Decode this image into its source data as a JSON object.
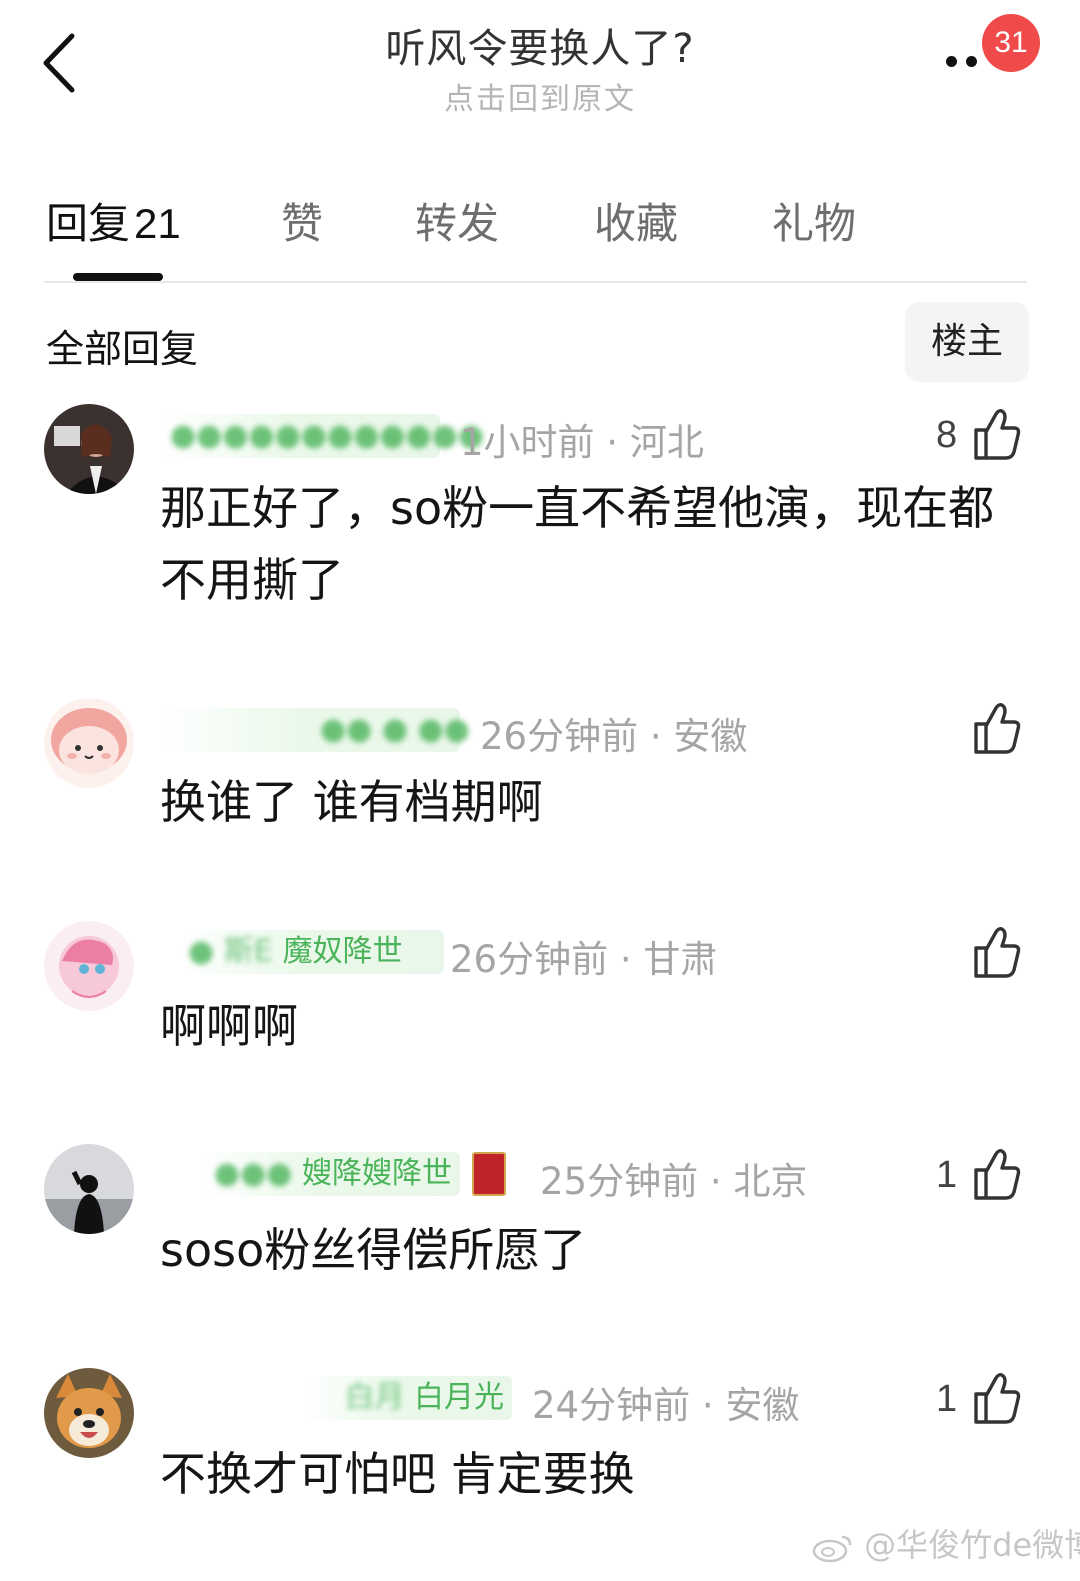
{
  "header": {
    "title": "听风令要换人了?",
    "subtitle": "点击回到原文",
    "badge_count": "31"
  },
  "tabs": [
    {
      "label": "回复",
      "count": "21"
    },
    {
      "label": "赞"
    },
    {
      "label": "转发"
    },
    {
      "label": "收藏"
    },
    {
      "label": "礼物"
    }
  ],
  "section": {
    "title": "全部回复",
    "op_button": "楼主"
  },
  "comments": [
    {
      "username_visible": "",
      "meta": "1小时前 · 河北",
      "likes": "8",
      "text": "那正好了，so粉一直不希望他演，现在都不用撕了"
    },
    {
      "username_visible": "",
      "meta": "26分钟前 · 安徽",
      "likes": "",
      "text": "换谁了 谁有档期啊"
    },
    {
      "username_visible": "魔奴降世",
      "meta": "26分钟前 · 甘肃",
      "likes": "",
      "text": "啊啊啊"
    },
    {
      "username_visible": "嫂降嫂降世",
      "meta": "25分钟前 · 北京",
      "likes": "1",
      "text": "soso粉丝得偿所愿了"
    },
    {
      "username_visible": "白月光",
      "meta": "24分钟前 · 安徽",
      "likes": "1",
      "text": "不换才可怕吧 肯定要换"
    }
  ],
  "watermark": "@华俊竹de微博",
  "colors": {
    "accent_badge": "#f04a4a",
    "username_green": "#4bb45a",
    "meta_gray": "#a5a5a5"
  },
  "icons": [
    "back-icon",
    "more-icon",
    "thumb-up-icon",
    "weibo-logo-icon"
  ]
}
